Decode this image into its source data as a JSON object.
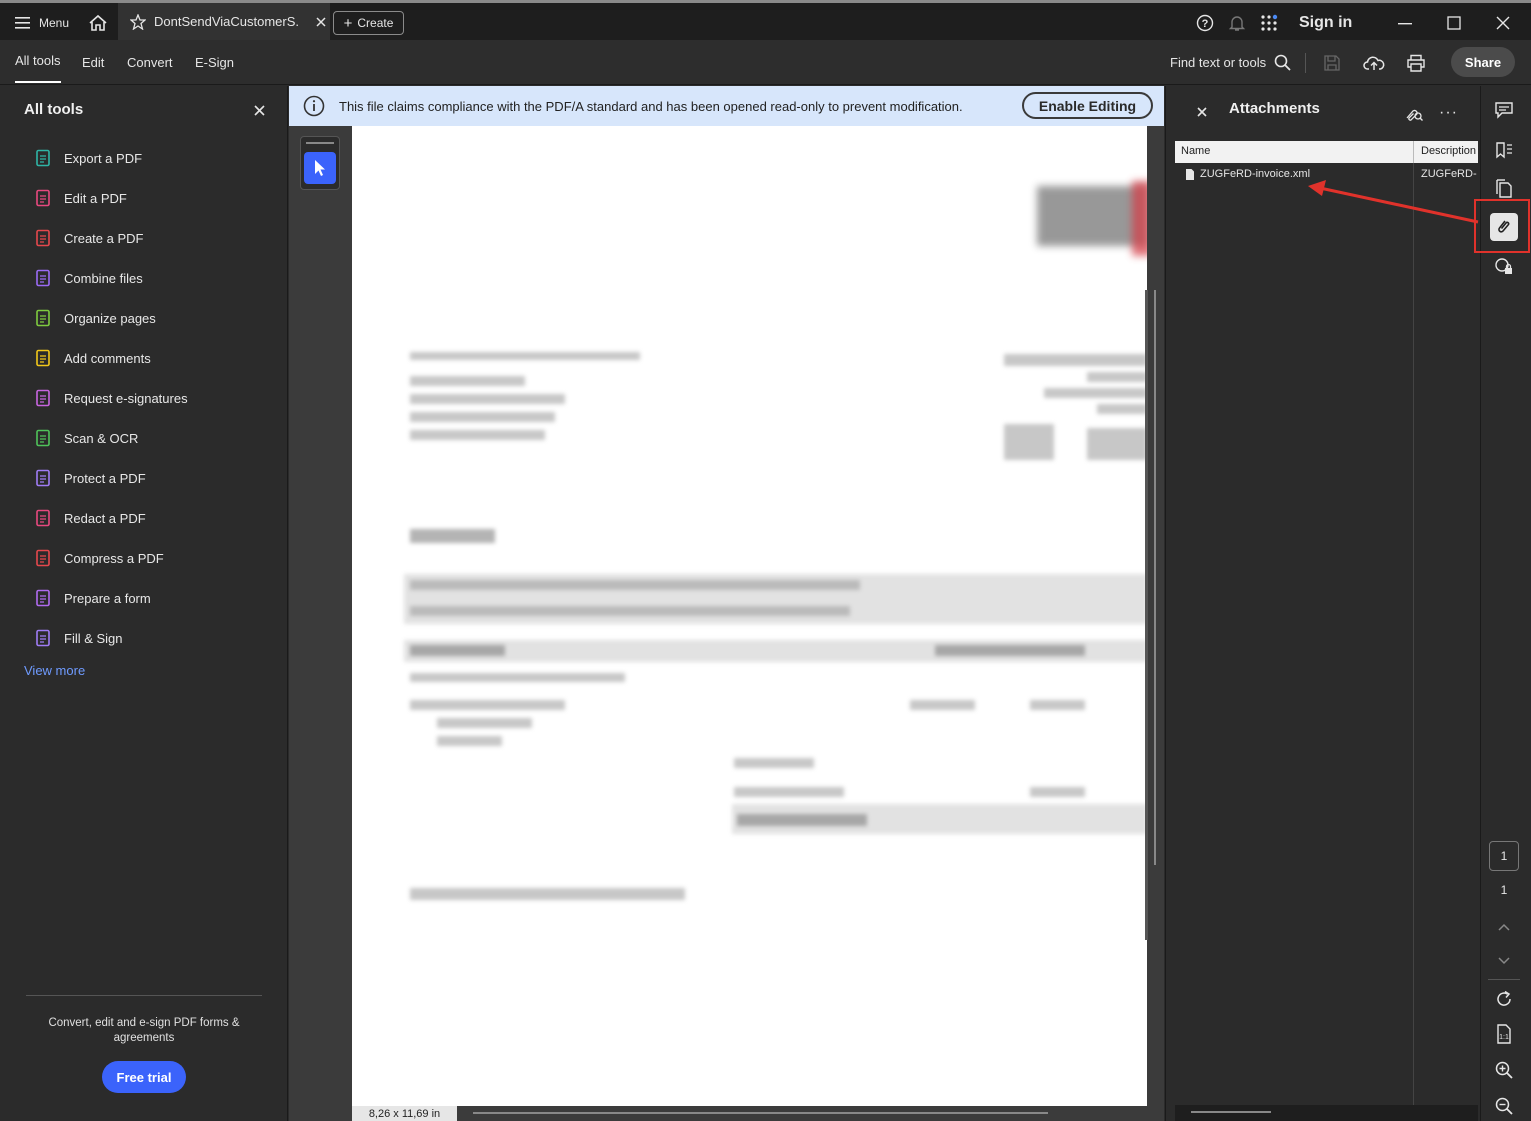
{
  "titlebar": {
    "menu_label": "Menu",
    "tab_title": "DontSendViaCustomerS...",
    "create_label": "Create",
    "sign_in_label": "Sign in"
  },
  "toolbar": {
    "tabs": [
      "All tools",
      "Edit",
      "Convert",
      "E-Sign"
    ],
    "find_label": "Find text or tools",
    "share_label": "Share"
  },
  "left_panel": {
    "title": "All tools",
    "tools": [
      {
        "label": "Export a PDF",
        "icon": "export-pdf-icon",
        "color": "#2fb5a6"
      },
      {
        "label": "Edit a PDF",
        "icon": "edit-pdf-icon",
        "color": "#e8497f"
      },
      {
        "label": "Create a PDF",
        "icon": "create-pdf-icon",
        "color": "#e5484d"
      },
      {
        "label": "Combine files",
        "icon": "combine-files-icon",
        "color": "#9b6bf5"
      },
      {
        "label": "Organize pages",
        "icon": "organize-pages-icon",
        "color": "#7fcb3f"
      },
      {
        "label": "Add comments",
        "icon": "add-comments-icon",
        "color": "#f2c81a"
      },
      {
        "label": "Request e-signatures",
        "icon": "request-esignatures-icon",
        "color": "#c865e0"
      },
      {
        "label": "Scan & OCR",
        "icon": "scan-ocr-icon",
        "color": "#4fc35a"
      },
      {
        "label": "Protect a PDF",
        "icon": "protect-pdf-icon",
        "color": "#a07cf5"
      },
      {
        "label": "Redact a PDF",
        "icon": "redact-pdf-icon",
        "color": "#e8497f"
      },
      {
        "label": "Compress a PDF",
        "icon": "compress-pdf-icon",
        "color": "#e5484d"
      },
      {
        "label": "Prepare a form",
        "icon": "prepare-form-icon",
        "color": "#b06bf0"
      },
      {
        "label": "Fill & Sign",
        "icon": "fill-sign-icon",
        "color": "#a07cf5"
      }
    ],
    "view_more": "View more",
    "promo_text": "Convert, edit and e-sign PDF forms & agreements",
    "free_trial_label": "Free trial"
  },
  "banner": {
    "message": "This file claims compliance with the PDF/A standard and has been opened read-only to prevent modification.",
    "enable_editing_label": "Enable Editing"
  },
  "document": {
    "page_size": "8,26 x 11,69 in"
  },
  "attachments": {
    "title": "Attachments",
    "columns": [
      "Name",
      "Description"
    ],
    "rows": [
      {
        "name": "ZUGFeRD-invoice.xml",
        "description": "ZUGFeRD-i"
      }
    ]
  },
  "page_nav": {
    "current_page": "1",
    "total_pages": "1"
  },
  "colors": {
    "accent_blue": "#3b63fb",
    "highlight_red": "#e0322b",
    "banner_bg": "#d7e6fb"
  }
}
